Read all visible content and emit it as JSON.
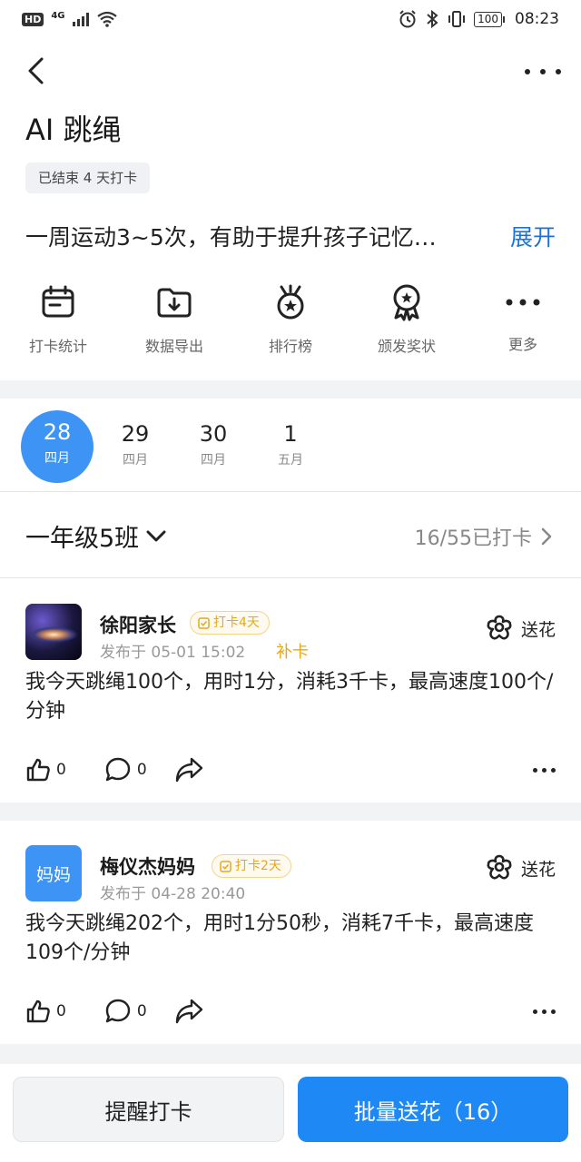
{
  "status_bar": {
    "network_badge": "HD",
    "network_type": "4G",
    "battery": "100",
    "time": "08:23"
  },
  "header": {
    "title": "AI 跳绳",
    "status_tag": "已结束 4 天打卡",
    "description": "一周运动3~5次，有助于提升孩子记忆…",
    "expand_label": "展开"
  },
  "actions": [
    {
      "label": "打卡统计",
      "icon": "calendar-icon"
    },
    {
      "label": "数据导出",
      "icon": "folder-download-icon"
    },
    {
      "label": "排行榜",
      "icon": "medal-icon"
    },
    {
      "label": "颁发奖状",
      "icon": "award-ribbon-icon"
    },
    {
      "label": "更多",
      "icon": "more-icon"
    }
  ],
  "dates": [
    {
      "day": "28",
      "month": "四月",
      "active": true
    },
    {
      "day": "29",
      "month": "四月",
      "active": false
    },
    {
      "day": "30",
      "month": "四月",
      "active": false
    },
    {
      "day": "1",
      "month": "五月",
      "active": false
    }
  ],
  "class_filter": {
    "name": "一年级5班",
    "checkin_count": "16/55已打卡"
  },
  "posts": [
    {
      "author": "徐阳家长",
      "avatar_icon": "galaxy-avatar",
      "streak": "打卡4天",
      "time": "发布于 05-01 15:02",
      "makeup": "补卡",
      "flower_label": "送花",
      "body": "我今天跳绳100个，用时1分，消耗3千卡，最高速度100个/分钟",
      "likes": "0",
      "comments": "0"
    },
    {
      "author": "梅仪杰妈妈",
      "avatar_text": "妈妈",
      "streak": "打卡2天",
      "time": "发布于 04-28 20:40",
      "flower_label": "送花",
      "body": "我今天跳绳202个，用时1分50秒，消耗7千卡，最高速度109个/分钟",
      "likes": "0",
      "comments": "0"
    }
  ],
  "bottom_bar": {
    "remind_label": "提醒打卡",
    "batch_flower_label": "批量送花（16）"
  },
  "colors": {
    "accent": "#1e88f5",
    "date_active": "#3d94f5",
    "streak": "#e6a817",
    "link": "#1a73d9"
  }
}
